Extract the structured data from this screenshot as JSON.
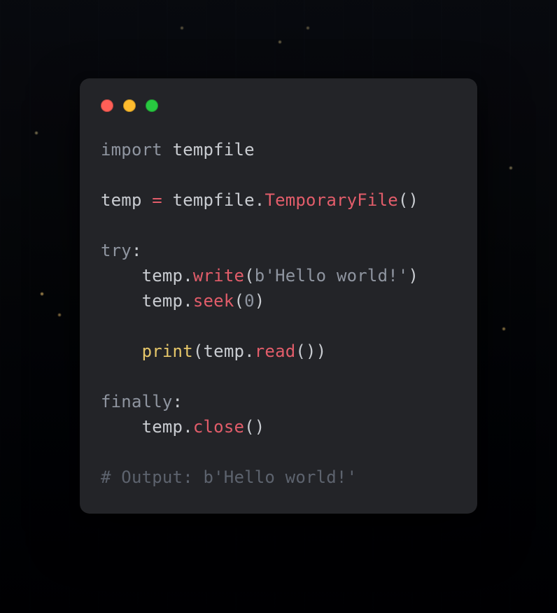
{
  "window": {
    "traffic_lights": {
      "close_color": "#ff5f57",
      "minimize_color": "#febc2e",
      "zoom_color": "#28c840"
    }
  },
  "code": {
    "language": "python",
    "lines": [
      {
        "indent": 0,
        "tokens": [
          {
            "t": "import",
            "c": "kw"
          },
          {
            "t": " ",
            "c": "ws"
          },
          {
            "t": "tempfile",
            "c": "ident"
          }
        ]
      },
      {
        "indent": 0,
        "tokens": []
      },
      {
        "indent": 0,
        "tokens": [
          {
            "t": "temp",
            "c": "ident"
          },
          {
            "t": " ",
            "c": "ws"
          },
          {
            "t": "=",
            "c": "op"
          },
          {
            "t": " ",
            "c": "ws"
          },
          {
            "t": "tempfile",
            "c": "ident"
          },
          {
            "t": ".",
            "c": "punct"
          },
          {
            "t": "TemporaryFile",
            "c": "type"
          },
          {
            "t": "(",
            "c": "punct"
          },
          {
            "t": ")",
            "c": "punct"
          }
        ]
      },
      {
        "indent": 0,
        "tokens": []
      },
      {
        "indent": 0,
        "tokens": [
          {
            "t": "try",
            "c": "kw"
          },
          {
            "t": ":",
            "c": "punct"
          }
        ]
      },
      {
        "indent": 1,
        "tokens": [
          {
            "t": "temp",
            "c": "ident"
          },
          {
            "t": ".",
            "c": "punct"
          },
          {
            "t": "write",
            "c": "method"
          },
          {
            "t": "(",
            "c": "punct"
          },
          {
            "t": "b",
            "c": "strpre"
          },
          {
            "t": "'Hello world!'",
            "c": "str"
          },
          {
            "t": ")",
            "c": "punct"
          }
        ]
      },
      {
        "indent": 1,
        "tokens": [
          {
            "t": "temp",
            "c": "ident"
          },
          {
            "t": ".",
            "c": "punct"
          },
          {
            "t": "seek",
            "c": "method"
          },
          {
            "t": "(",
            "c": "punct"
          },
          {
            "t": "0",
            "c": "num"
          },
          {
            "t": ")",
            "c": "punct"
          }
        ]
      },
      {
        "indent": 0,
        "tokens": []
      },
      {
        "indent": 1,
        "tokens": [
          {
            "t": "print",
            "c": "builtin"
          },
          {
            "t": "(",
            "c": "punct"
          },
          {
            "t": "temp",
            "c": "ident"
          },
          {
            "t": ".",
            "c": "punct"
          },
          {
            "t": "read",
            "c": "method"
          },
          {
            "t": "(",
            "c": "punct"
          },
          {
            "t": ")",
            "c": "punct"
          },
          {
            "t": ")",
            "c": "punct"
          }
        ]
      },
      {
        "indent": 0,
        "tokens": []
      },
      {
        "indent": 0,
        "tokens": [
          {
            "t": "finally",
            "c": "kw"
          },
          {
            "t": ":",
            "c": "punct"
          }
        ]
      },
      {
        "indent": 1,
        "tokens": [
          {
            "t": "temp",
            "c": "ident"
          },
          {
            "t": ".",
            "c": "punct"
          },
          {
            "t": "close",
            "c": "method"
          },
          {
            "t": "(",
            "c": "punct"
          },
          {
            "t": ")",
            "c": "punct"
          }
        ]
      },
      {
        "indent": 0,
        "tokens": []
      },
      {
        "indent": 0,
        "tokens": [
          {
            "t": "# Output: b'Hello world!'",
            "c": "comment"
          }
        ]
      }
    ],
    "indent_unit": "    "
  }
}
